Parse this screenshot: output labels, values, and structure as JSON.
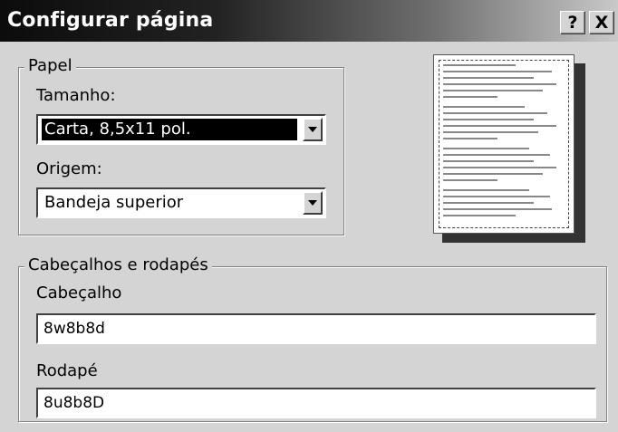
{
  "window": {
    "title": "Configurar página",
    "help_button": "?",
    "close_button": "X"
  },
  "paper": {
    "legend": "Papel",
    "size_label": "Tamanho:",
    "size_value": "Carta, 8,5x11 pol.",
    "source_label": "Origem:",
    "source_value": "Bandeja superior"
  },
  "headers_footers": {
    "legend": "Cabeçalhos e rodapés",
    "header_label": "Cabeçalho",
    "header_value": "8w8b8d",
    "footer_label": "Rodapé",
    "footer_value": "8u8b8D"
  }
}
